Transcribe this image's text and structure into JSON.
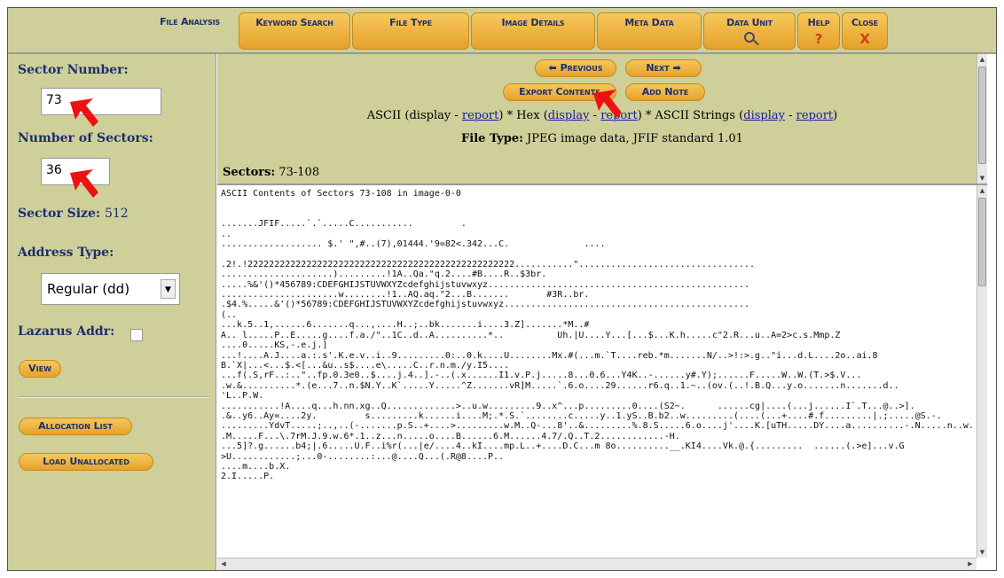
{
  "menu": {
    "items": [
      {
        "label": "File Analysis"
      },
      {
        "label": "Keyword Search"
      },
      {
        "label": "File Type"
      },
      {
        "label": "Image Details"
      },
      {
        "label": "Meta Data"
      },
      {
        "label": "Data Unit"
      },
      {
        "label": "Help",
        "glyph": "?"
      },
      {
        "label": "Close",
        "glyph": "X"
      }
    ]
  },
  "sidebar": {
    "sector_number_label": "Sector Number:",
    "sector_number_value": "73",
    "num_sectors_label": "Number of Sectors:",
    "num_sectors_value": "36",
    "sector_size_label": "Sector Size:",
    "sector_size_value": "512",
    "address_type_label": "Address Type:",
    "address_type_value": "Regular (dd)",
    "lazarus_label": "Lazarus Addr:",
    "view_button": "View",
    "allocation_list_button": "Allocation List",
    "load_unallocated_button": "Load Unallocated"
  },
  "panel": {
    "previous_button": "Previous",
    "next_button": "Next",
    "export_button": "Export Contents",
    "add_note_button": "Add Note",
    "line_ascii_prefix": "ASCII (display - ",
    "link_report_1": "report",
    "line_hex_mid": ") * Hex (",
    "link_display_2": "display",
    "dash_1": " - ",
    "link_report_2": "report",
    "line_strings_mid": ") * ASCII Strings (",
    "link_display_3": "display",
    "dash_2": " - ",
    "link_report_3": "report",
    "close_paren": ")",
    "file_type_label": "File Type:",
    "file_type_value": " JPEG image data, JFIF standard 1.01",
    "sectors_label": "Sectors:",
    "sectors_value": " 73-108"
  },
  "content": {
    "text": "ASCII Contents of Sectors 73-108 in image-0-0\n\n\n.......JFIF.....`.`.....C...........         .\n..\n................... $.' \",#..(7),01444.'9=82<.342...C.              ....\n\n.2!.!22222222222222222222222222222222222222222222222222...........\".................................\n.....................).........!1A..Qa.\"q.2....#B....R..$3br.\n.....%&'()*456789:CDEFGHIJSTUVWXYZcdefghijstuvwxyz.................................................\n......................w........!1..AQ.aq.\"2...B.......       #3R..br.\n.$4.%.....&'()*56789:CDEFGHIJSTUVWXYZcdefghijstuvwxyz..............................................\n(..\n...k.5..1,......6.......q...,....H..;..bk.......i....3.Z].......*M..#\nA.. l.....P..E.....g....f.a./\"..1C..d..A..........*..          Uh.|U....Y...[...$...K.h.....c\"2.R...u..A=2>c.s.Mmp.Z\n....0.....KS,-.e.j.]\n...!....A.J....a.:.s'.K.e.v..i..9.........0:..0.k....U........Mx.#(...m.`T....reb.*m.......N/..>!:>.g..\"i...d.L....2o..ai.8\nB.`X|...<...$.<[...&u..s$....e\\.....C..r.n.m./y.I5....\n...f(.S,rF..:..\"..fp.0.3e0..$....j.4..].-..(.x......I1.v.P.j.....8...0.6...Y4K..-......y#.Y);......F.....W..W.(T.>$.V...\n.w.&..........*.(e...7..n.$N.Y..K`.....Y.....^Z.......vR]M.....`.6.o....29......r6.q..1.~..(ov.(..!.B.Q...y.o.......n.......d..\n'L..P.W.\n...........!A....q...h.nn.xg..Q.............>..u.w.........9..x^...p.........0....(S2~.      ......cg|....(...j......I`.T...@..>].\n.&..y6..Ay=....2y.         s.........k......i....M;.*.S.`........c.....y..1.yS..B.b2..w.........(....(...+....#.f.........|.;.....@S.-.\n.........YdvT.....;..,..(-.......p.S..+....>.........w.M..Q-...8'..&.........%.8.S.....6.o....j'....K.[uTH.....DY....a..........-.N.....n..w.\n.M.....F...\\.7rM.J.9.w.6*.1..z...n.....o....B......6.M......4.7/.Q..T.2............-H.\n...5]?.g......b4;|.6.....U.F..i%r(...|e/....4..kI....mp.L..+....D.C...m 8o..........__.KI4....Vk.@.{.........  ......(.>e]...v.G\n>U............;...0-........:...@....Q...(.R@8....P..\n....m....b.X.\n2.I.....P.\n"
  }
}
